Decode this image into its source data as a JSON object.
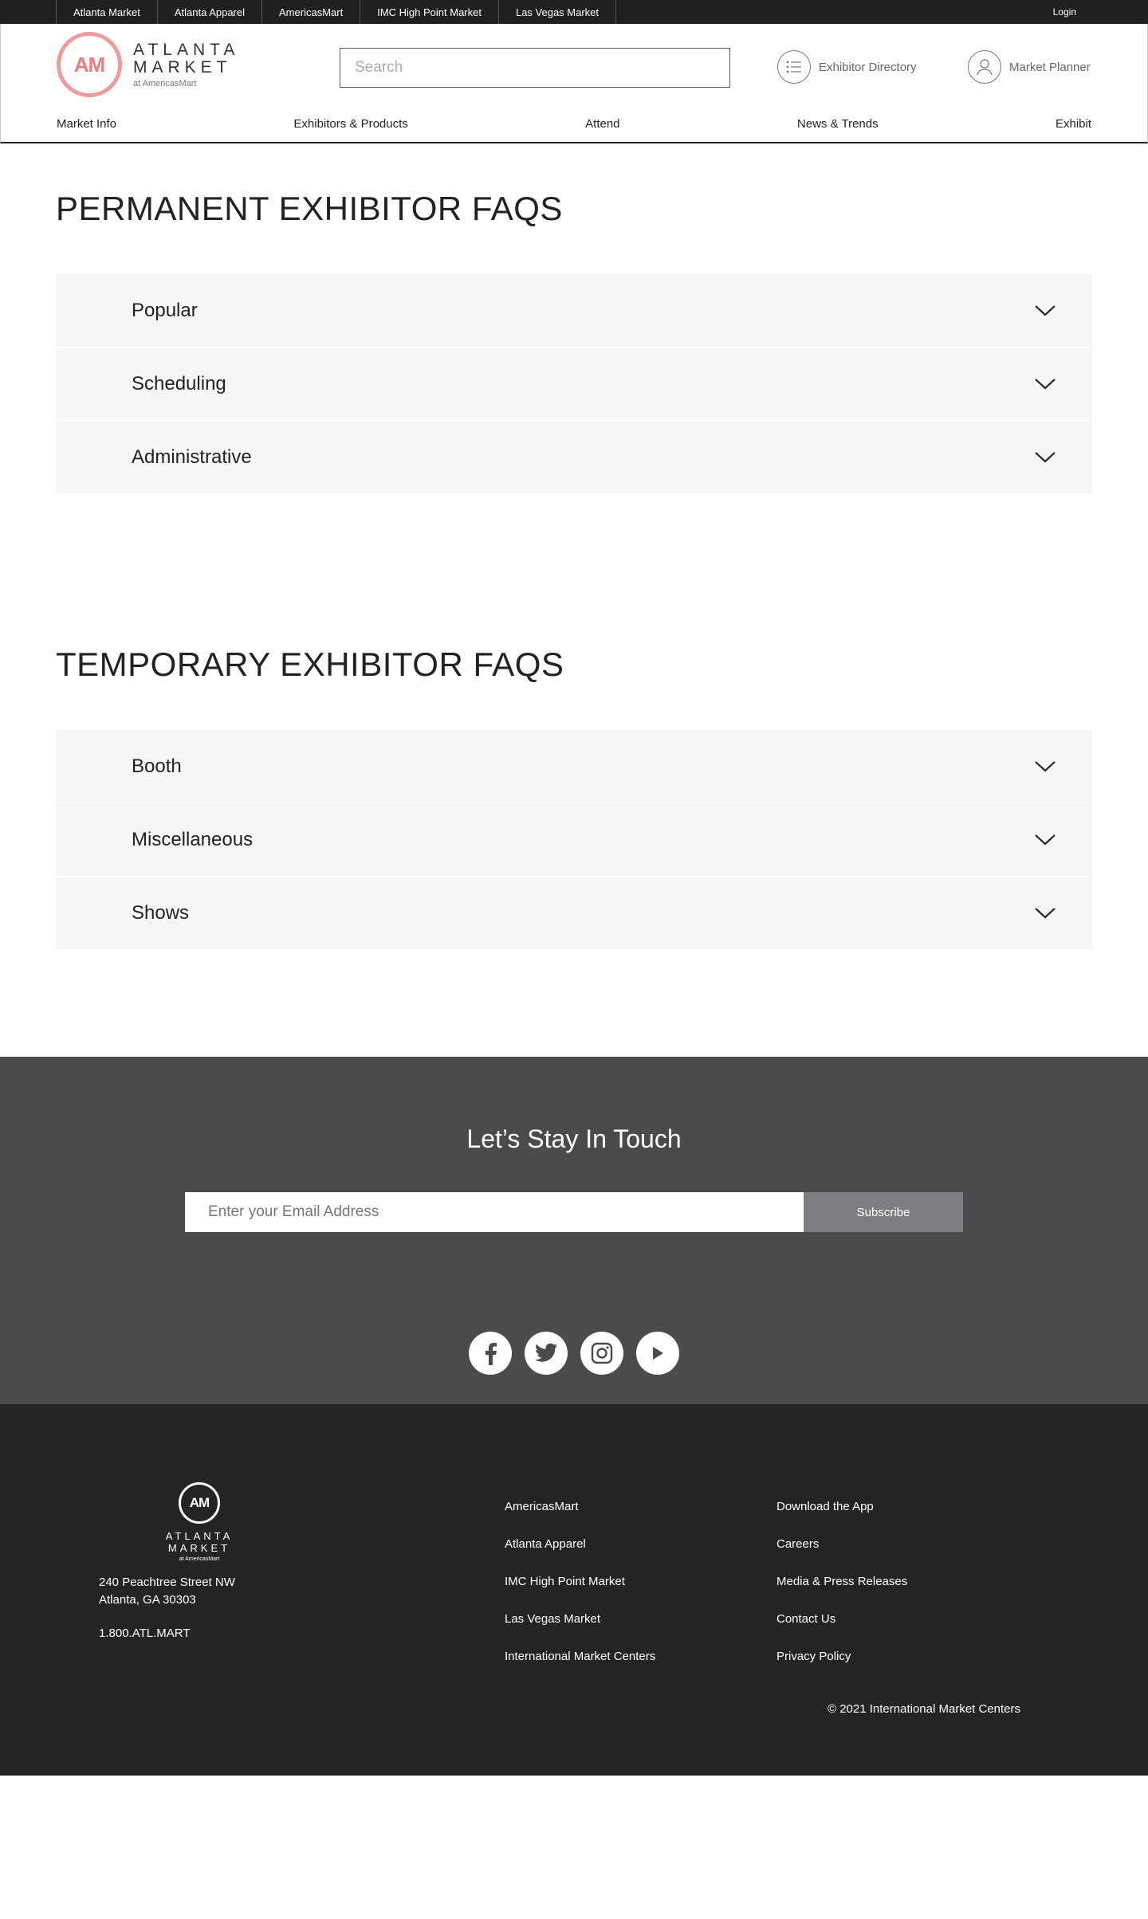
{
  "topbar": {
    "sites": [
      "Atlanta Market",
      "Atlanta Apparel",
      "AmericasMart",
      "IMC High Point Market",
      "Las Vegas Market"
    ],
    "login": "Login"
  },
  "header": {
    "logo": {
      "mark": "AM",
      "line1": "ATLANTA",
      "line2": "MARKET",
      "line3": "at AmericasMart"
    },
    "search_placeholder": "Search",
    "exhibitor_directory": "Exhibitor Directory",
    "market_planner": "Market Planner",
    "nav": [
      "Market Info",
      "Exhibitors & Products",
      "Attend",
      "News & Trends",
      "Exhibit"
    ]
  },
  "permanent": {
    "title": "PERMANENT EXHIBITOR FAQS",
    "items": [
      "Popular",
      "Scheduling",
      "Administrative"
    ]
  },
  "temporary": {
    "title": "TEMPORARY EXHIBITOR FAQS",
    "items": [
      "Booth",
      "Miscellaneous",
      "Shows"
    ]
  },
  "touch": {
    "title": "Let’s Stay In Touch",
    "email_placeholder": "Enter your Email Address",
    "subscribe": "Subscribe",
    "socials": [
      "facebook-icon",
      "twitter-icon",
      "instagram-icon",
      "youtube-icon"
    ]
  },
  "footer": {
    "logo": {
      "mark": "AM",
      "line1": "ATLANTA MARKET",
      "line2": "at AmericasMart"
    },
    "address1": "240 Peachtree Street NW",
    "address2": "Atlanta, GA 30303",
    "phone": "1.800.ATL.MART",
    "col1": [
      "AmericasMart",
      "Atlanta Apparel",
      "IMC High Point Market",
      "Las Vegas Market",
      "International Market Centers"
    ],
    "col2": [
      "Download the App",
      "Careers",
      "Media & Press Releases",
      "Contact Us",
      "Privacy Policy"
    ],
    "copyright": "© 2021 International Market Centers"
  },
  "colors": {
    "topbar": "#1e2022",
    "accent": "#ef9a9c",
    "touch_bg": "#4b4b4b",
    "footer_bg": "#242424",
    "accordion_bg": "#f6f6f6"
  }
}
